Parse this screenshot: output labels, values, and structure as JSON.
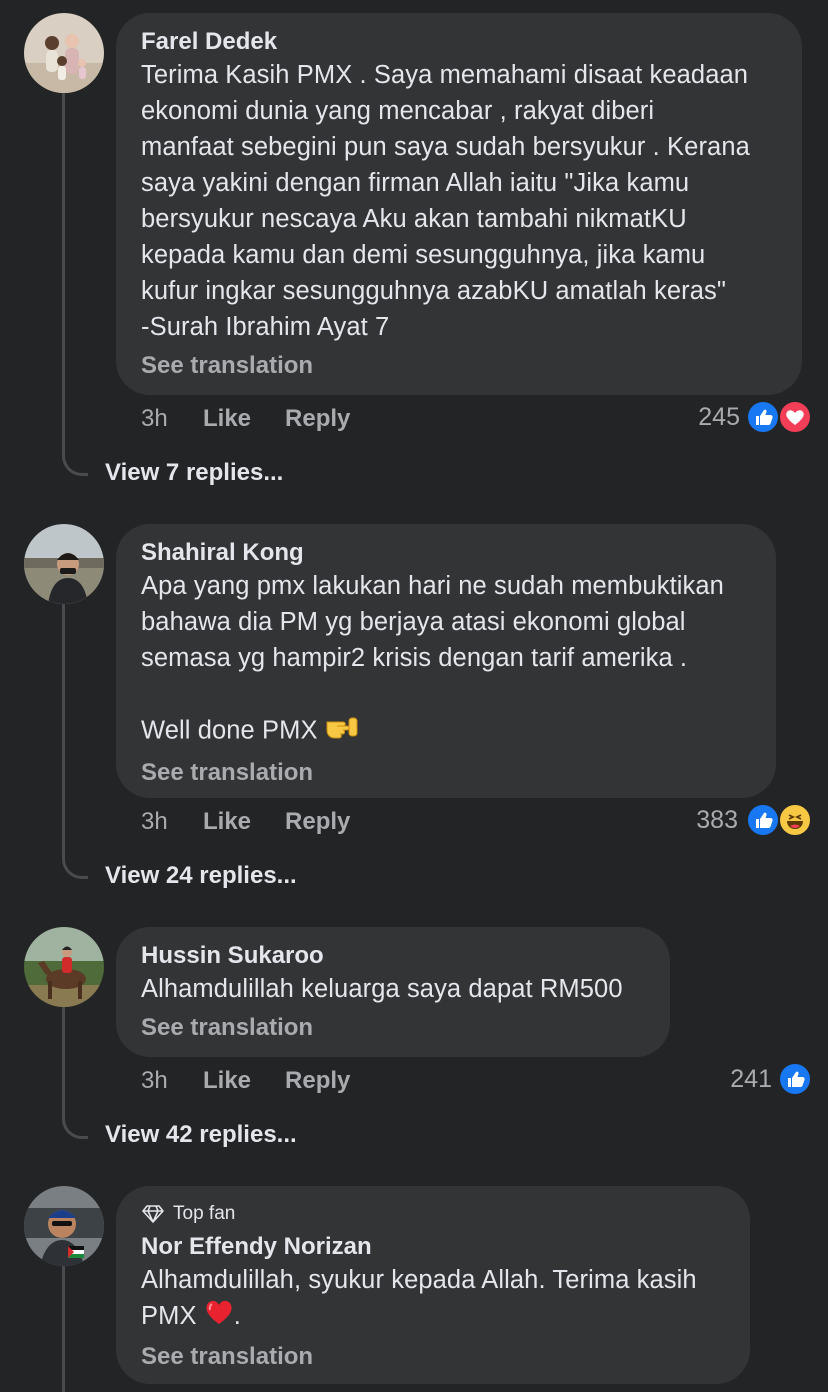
{
  "comments": [
    {
      "name": "Farel Dedek",
      "text": "Terima Kasih PMX . Saya memahami disaat keadaan\nekonomi dunia yang mencabar , rakyat diberi\nmanfaat sebegini pun saya sudah bersyukur . Kerana\nsaya yakini dengan firman Allah iaitu \"Jika kamu\nbersyukur nescaya Aku akan tambahi nikmatKU\nkepada kamu dan demi sesungguhnya, jika kamu\nkufur ingkar sesungguhnya azabKU amatlah keras\"\n-Surah Ibrahim Ayat 7",
      "see_translation": "See translation",
      "time": "3h",
      "like": "Like",
      "reply": "Reply",
      "reaction_count": "245",
      "reactions": [
        "like-icon",
        "love-icon"
      ],
      "view_replies": "View 7 replies..."
    },
    {
      "name": "Shahiral Kong",
      "text": "Apa yang pmx lakukan hari ne sudah membuktikan\nbahawa dia PM yg berjaya atasi ekonomi global\nsemasa yg hampir2 krisis dengan tarif amerika .\n\nWell done PMX",
      "emoji": "salute-hand-emoji",
      "see_translation": "See translation",
      "time": "3h",
      "like": "Like",
      "reply": "Reply",
      "reaction_count": "383",
      "reactions": [
        "like-icon",
        "haha-icon"
      ],
      "view_replies": "View 24 replies..."
    },
    {
      "name": "Hussin Sukaroo",
      "text": "Alhamdulillah keluarga saya dapat RM500",
      "see_translation": "See translation",
      "time": "3h",
      "like": "Like",
      "reply": "Reply",
      "reaction_count": "241",
      "reactions": [
        "like-icon"
      ],
      "view_replies": "View 42 replies..."
    },
    {
      "badge": "Top fan",
      "badge_icon": "diamond-icon",
      "name": "Nor Effendy Norizan",
      "text_line1": "Alhamdulillah, syukur kepada Allah. Terima kasih",
      "text_line2_before": "PMX",
      "text_line2_after": ".",
      "emoji": "red-heart-emoji",
      "see_translation": "See translation"
    }
  ],
  "colors": {
    "background": "#232426",
    "bubble": "#323436",
    "text": "#e4e6eb",
    "muted": "#a9abaf",
    "like_blue": "#1877f2",
    "love_red": "#f33e58",
    "haha_yellow": "#f7c843"
  }
}
